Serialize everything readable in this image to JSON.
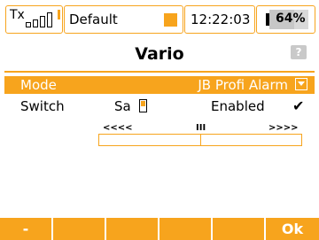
{
  "status": {
    "tx_label": "Tx",
    "model_name": "Default",
    "time": "12:22:03",
    "battery": "64%",
    "battery_level": 0.64
  },
  "page": {
    "title": "Vario",
    "help_label": "?"
  },
  "rows": {
    "mode": {
      "label": "Mode",
      "value": "JB Profi Alarm"
    },
    "switch": {
      "label": "Switch",
      "value": "Sa",
      "state": "Enabled",
      "check": "✔"
    }
  },
  "range": {
    "left_label": "<<<<",
    "center_label": "III",
    "right_label": ">>>>"
  },
  "softkeys": [
    "-",
    "",
    "",
    "",
    "",
    "Ok"
  ],
  "colors": {
    "accent": "#f7a41d"
  }
}
